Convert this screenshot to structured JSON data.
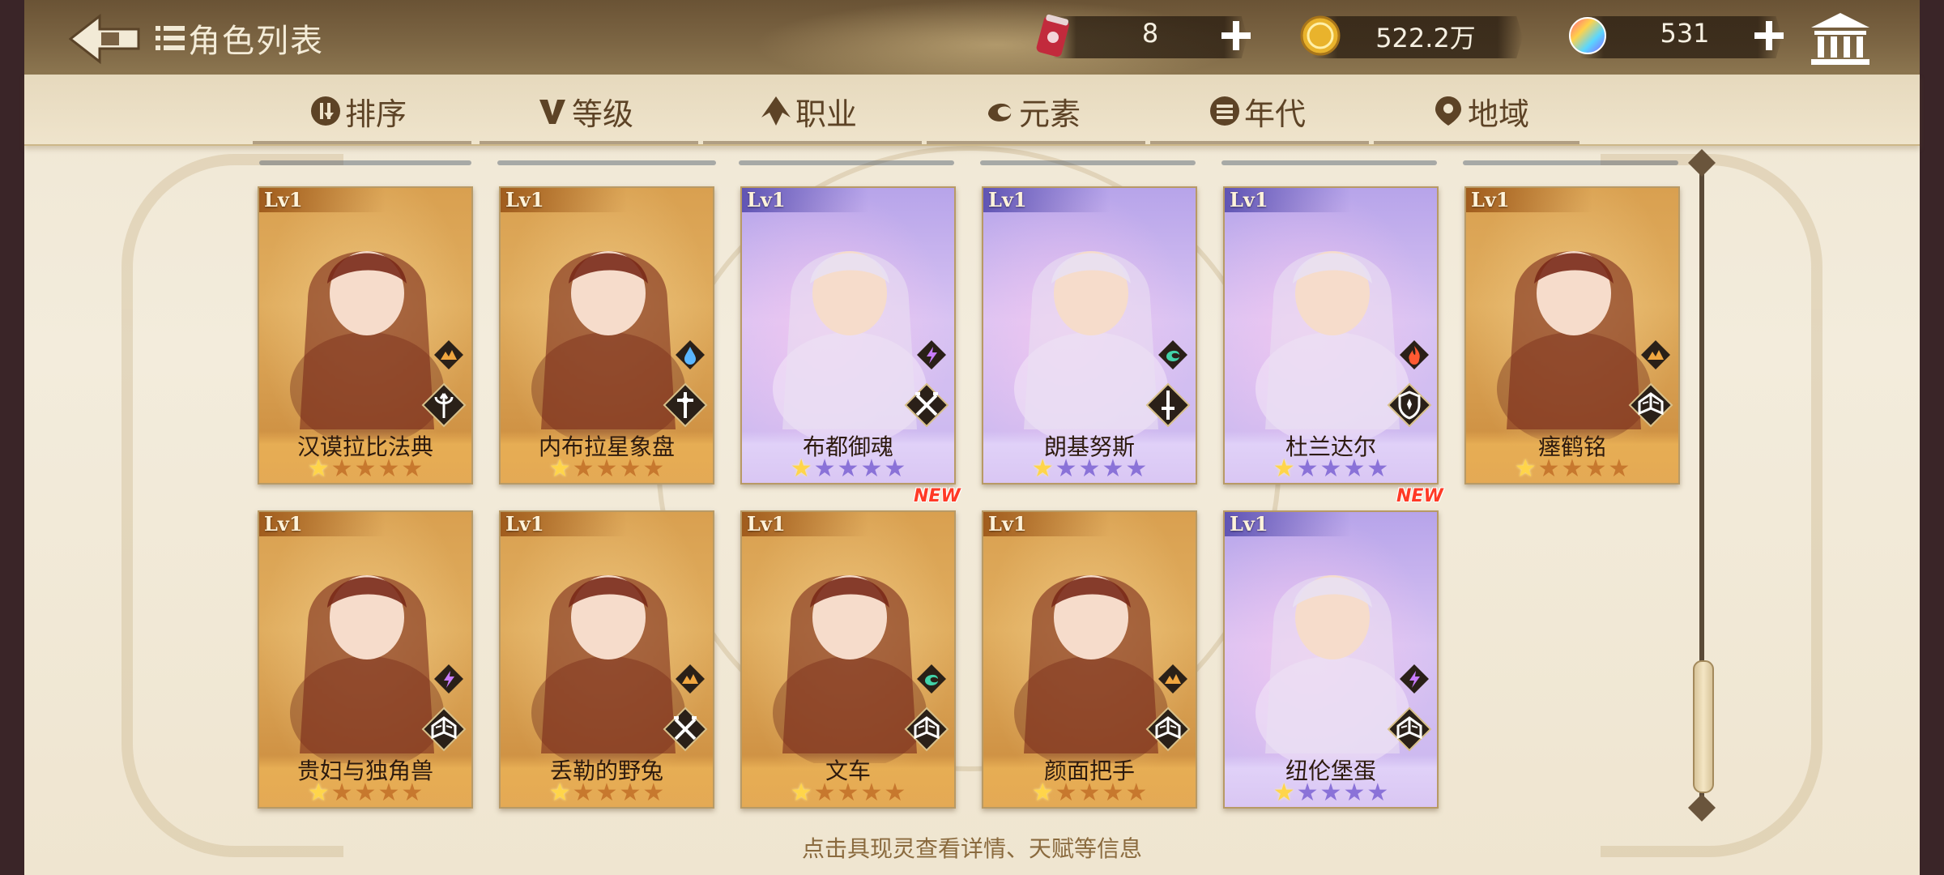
{
  "header": {
    "title": "角色列表",
    "resources": [
      {
        "name": "stamina",
        "icon": "drink-can-icon",
        "value": "8"
      },
      {
        "name": "gold",
        "icon": "gold-coin-icon",
        "value": "522.2万"
      },
      {
        "name": "gem",
        "icon": "rainbow-gem-icon",
        "value": "531"
      }
    ]
  },
  "filters": [
    {
      "label": "排序",
      "icon": "sort-icon"
    },
    {
      "label": "等级",
      "icon": "level-v-icon"
    },
    {
      "label": "职业",
      "icon": "class-icon"
    },
    {
      "label": "元素",
      "icon": "element-swirl-icon"
    },
    {
      "label": "年代",
      "icon": "era-icon"
    },
    {
      "label": "地域",
      "icon": "location-pin-icon"
    }
  ],
  "cards": [
    {
      "name": "汉谟拉比法典",
      "level": "Lv1",
      "rarity": "gold",
      "stars": 1,
      "new": false,
      "element": "earth",
      "class": "trident"
    },
    {
      "name": "内布拉星象盘",
      "level": "Lv1",
      "rarity": "gold",
      "stars": 1,
      "new": false,
      "element": "water",
      "class": "cross"
    },
    {
      "name": "布都御魂",
      "level": "Lv1",
      "rarity": "purple",
      "stars": 1,
      "new": false,
      "element": "thunder",
      "class": "crossed-swords"
    },
    {
      "name": "朗基努斯",
      "level": "Lv1",
      "rarity": "purple",
      "stars": 1,
      "new": false,
      "element": "wind",
      "class": "sword"
    },
    {
      "name": "杜兰达尔",
      "level": "Lv1",
      "rarity": "purple",
      "stars": 1,
      "new": false,
      "element": "fire",
      "class": "shield"
    },
    {
      "name": "瘗鹤铭",
      "level": "Lv1",
      "rarity": "gold",
      "stars": 1,
      "new": false,
      "element": "earth",
      "class": "book"
    },
    {
      "name": "贵妇与独角兽",
      "level": "Lv1",
      "rarity": "gold",
      "stars": 1,
      "new": false,
      "element": "thunder",
      "class": "book"
    },
    {
      "name": "丢勒的野兔",
      "level": "Lv1",
      "rarity": "gold",
      "stars": 1,
      "new": false,
      "element": "earth",
      "class": "crossed-swords"
    },
    {
      "name": "文车",
      "level": "Lv1",
      "rarity": "gold",
      "stars": 1,
      "new": true,
      "element": "wind",
      "class": "book"
    },
    {
      "name": "颜面把手",
      "level": "Lv1",
      "rarity": "gold",
      "stars": 1,
      "new": false,
      "element": "earth",
      "class": "book"
    },
    {
      "name": "纽伦堡蛋",
      "level": "Lv1",
      "rarity": "purple",
      "stars": 1,
      "new": true,
      "element": "thunder",
      "class": "book"
    }
  ],
  "new_label": "NEW",
  "footer_hint": "点击具现灵查看详情、天赋等信息",
  "colors": {
    "gold_card": "#dca55a",
    "purple_card": "#c9b6ef",
    "topbar": "#75603f",
    "text_brown": "#5d4326"
  }
}
